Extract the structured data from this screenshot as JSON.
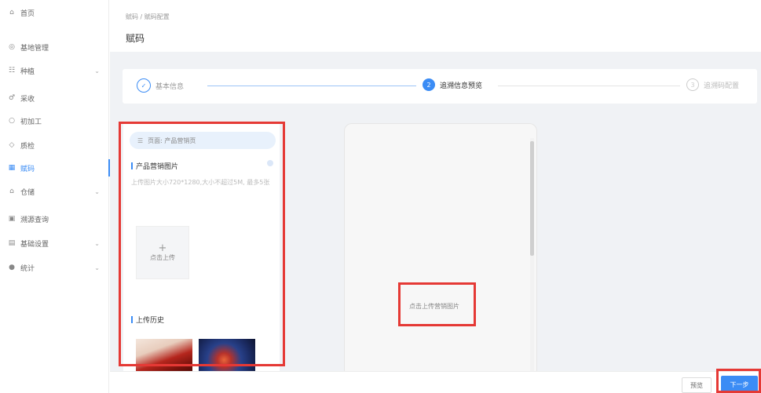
{
  "sidebar": {
    "items": [
      {
        "icon": "home-icon",
        "glyph": "⌂",
        "label": "首页"
      },
      {
        "icon": "location-icon",
        "glyph": "◎",
        "label": "基地管理"
      },
      {
        "icon": "grid-icon",
        "glyph": "☷",
        "label": "种植"
      },
      {
        "icon": "leaf-icon",
        "glyph": "♂",
        "label": "采收"
      },
      {
        "icon": "refresh-icon",
        "glyph": "○",
        "label": "初加工"
      },
      {
        "icon": "shield-icon",
        "glyph": "◇",
        "label": "质检"
      },
      {
        "icon": "qrcode-icon",
        "glyph": "▦",
        "label": "赋码"
      },
      {
        "icon": "warehouse-icon",
        "glyph": "⌂",
        "label": "仓储"
      },
      {
        "icon": "search-icon",
        "glyph": "▣",
        "label": "溯源查询"
      },
      {
        "icon": "settings-icon",
        "glyph": "▤",
        "label": "基础设置"
      },
      {
        "icon": "chart-icon",
        "glyph": "●",
        "label": "统计"
      }
    ]
  },
  "header": {
    "breadcrumb": "赋码 / 赋码配置",
    "title": "赋码"
  },
  "steps": [
    {
      "num": "✓",
      "label": "基本信息"
    },
    {
      "num": "2",
      "label": "追溯信息预览"
    },
    {
      "num": "3",
      "label": "追溯码配置"
    }
  ],
  "left_panel": {
    "page_select": "页面: 产品营销页",
    "section_images": "产品营销图片",
    "upload_hint": "上传图片大小720*1280,大小不超过5M, 最多5张",
    "upload_plus": "+",
    "upload_label": "点击上传",
    "section_history": "上传历史"
  },
  "phone": {
    "hint": "点击上传营销图片"
  },
  "buttons": {
    "prev": "预览",
    "next": "下一步"
  },
  "colors": {
    "primary": "#3b8cf5",
    "highlight": "#e53935"
  }
}
